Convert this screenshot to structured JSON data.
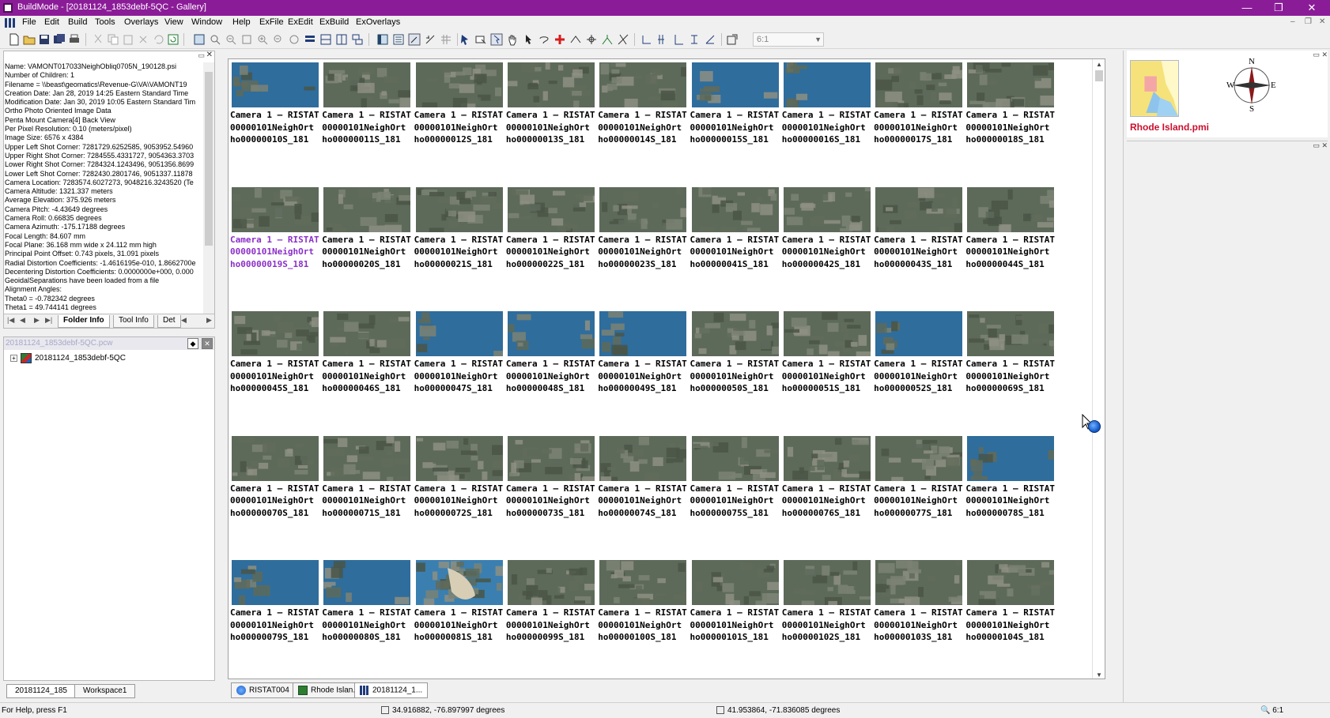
{
  "window": {
    "title": "BuildMode - [20181124_1853debf-5QC - Gallery]",
    "minimize": "—",
    "maximize": "❐",
    "close": "✕"
  },
  "menubar": {
    "items": [
      "File",
      "Edit",
      "Build",
      "Tools",
      "Overlays",
      "View",
      "Window",
      "Help",
      "ExFile",
      "ExEdit",
      "ExBuild",
      "ExOverlays"
    ],
    "mdi_minimize": "–",
    "mdi_restore": "❐",
    "mdi_close": "✕"
  },
  "toolbar": {
    "zoom_value": "6:1"
  },
  "info_panel": {
    "lines": [
      "Name: VAMONT017033NeighObliq0705N_190128.psi",
      "Number of Children: 1",
      "Filename = \\\\beast\\geomatics\\Revenue-G\\VA\\VAMONT19",
      "Creation Date: Jan 28, 2019 14:25 Eastern Standard Time",
      "Modification Date: Jan 30, 2019 10:05 Eastern Standard Tim",
      "Ortho Photo Oriented Image Data",
      "Penta Mount Camera[4]          Back View",
      "Per Pixel Resolution: 0.10 (meters/pixel)",
      "Image Size: 6576 x 4384",
      "Upper Left Shot Corner: 7281729.6252585, 9053952.54960",
      "Upper Right Shot Corner: 7284555.4331727, 9054363.3703",
      "Lower Right Shot Corner: 7284324.1243496, 9051356.8699",
      "Lower Left Shot Corner: 7282430.2801746, 9051337.11878",
      "Camera Location: 7283574.6027273, 9048216.3243520 (Te",
      "Camera Altitude: 1321.337 meters",
      "Average Elevation: 375.926 meters",
      "Camera Pitch: -4.43649 degrees",
      "Camera Roll: 0.66835 degrees",
      "Camera Azimuth: -175.17188 degrees",
      "Focal Length: 84.607 mm",
      "Focal Plane: 36.168 mm wide x 24.112 mm high",
      "Principal Point Offset: 0.743 pixels, 31.091 pixels",
      "Radial Distortion Coefficients: -1.4616195e-010, 1.8662700e",
      "Decentering Distortion Coefficients: 0.0000000e+000, 0.000",
      "GeoidalSeparations have been loaded from a file",
      "Alignment Angles:",
      "  Theta0 = -0.782342 degrees",
      "  Theta1 = 49.744141 degrees"
    ],
    "tabs": [
      "Folder Info",
      "Tool Info",
      "Det"
    ]
  },
  "tree_panel": {
    "header": "20181124_1853debf-5QC.pcw",
    "root_label": "20181124_1853debf-5QC"
  },
  "left_bottom_tabs": [
    "20181124_185",
    "Workspace1"
  ],
  "gallery": {
    "rows": [
      [
        [
          "Camera 1 — RISTAT",
          "00000101NeighOrt",
          "ho00000010S_181"
        ],
        [
          "Camera 1 — RISTAT",
          "00000101NeighOrt",
          "ho00000011S_181"
        ],
        [
          "Camera 1 — RISTAT",
          "00000101NeighOrt",
          "ho00000012S_181"
        ],
        [
          "Camera 1 — RISTAT",
          "00000101NeighOrt",
          "ho00000013S_181"
        ],
        [
          "Camera 1 — RISTAT",
          "00000101NeighOrt",
          "ho00000014S_181"
        ],
        [
          "Camera 1 — RISTAT",
          "00000101NeighOrt",
          "ho00000015S_181"
        ],
        [
          "Camera 1 — RISTAT",
          "00000101NeighOrt",
          "ho00000016S_181"
        ],
        [
          "Camera 1 — RISTAT",
          "00000101NeighOrt",
          "ho00000017S_181"
        ],
        [
          "Camera 1 — RISTAT",
          "00000101NeighOrt",
          "ho00000018S_181"
        ]
      ],
      [
        [
          "Camera 1 — RISTAT",
          "00000101NeighOrt",
          "ho00000019S_181"
        ],
        [
          "Camera 1 — RISTAT",
          "00000101NeighOrt",
          "ho00000020S_181"
        ],
        [
          "Camera 1 — RISTAT",
          "00000101NeighOrt",
          "ho00000021S_181"
        ],
        [
          "Camera 1 — RISTAT",
          "00000101NeighOrt",
          "ho00000022S_181"
        ],
        [
          "Camera 1 — RISTAT",
          "00000101NeighOrt",
          "ho00000023S_181"
        ],
        [
          "Camera 1 — RISTAT",
          "00000101NeighOrt",
          "ho00000041S_181"
        ],
        [
          "Camera 1 — RISTAT",
          "00000101NeighOrt",
          "ho00000042S_181"
        ],
        [
          "Camera 1 — RISTAT",
          "00000101NeighOrt",
          "ho00000043S_181"
        ],
        [
          "Camera 1 — RISTAT",
          "00000101NeighOrt",
          "ho00000044S_181"
        ]
      ],
      [
        [
          "Camera 1 — RISTAT",
          "00000101NeighOrt",
          "ho00000045S_181"
        ],
        [
          "Camera 1 — RISTAT",
          "00000101NeighOrt",
          "ho00000046S_181"
        ],
        [
          "Camera 1 — RISTAT",
          "00000101NeighOrt",
          "ho00000047S_181"
        ],
        [
          "Camera 1 — RISTAT",
          "00000101NeighOrt",
          "ho00000048S_181"
        ],
        [
          "Camera 1 — RISTAT",
          "00000101NeighOrt",
          "ho00000049S_181"
        ],
        [
          "Camera 1 — RISTAT",
          "00000101NeighOrt",
          "ho00000050S_181"
        ],
        [
          "Camera 1 — RISTAT",
          "00000101NeighOrt",
          "ho00000051S_181"
        ],
        [
          "Camera 1 — RISTAT",
          "00000101NeighOrt",
          "ho00000052S_181"
        ],
        [
          "Camera 1 — RISTAT",
          "00000101NeighOrt",
          "ho00000069S_181"
        ]
      ],
      [
        [
          "Camera 1 — RISTAT",
          "00000101NeighOrt",
          "ho00000070S_181"
        ],
        [
          "Camera 1 — RISTAT",
          "00000101NeighOrt",
          "ho00000071S_181"
        ],
        [
          "Camera 1 — RISTAT",
          "00000101NeighOrt",
          "ho00000072S_181"
        ],
        [
          "Camera 1 — RISTAT",
          "00000101NeighOrt",
          "ho00000073S_181"
        ],
        [
          "Camera 1 — RISTAT",
          "00000101NeighOrt",
          "ho00000074S_181"
        ],
        [
          "Camera 1 — RISTAT",
          "00000101NeighOrt",
          "ho00000075S_181"
        ],
        [
          "Camera 1 — RISTAT",
          "00000101NeighOrt",
          "ho00000076S_181"
        ],
        [
          "Camera 1 — RISTAT",
          "00000101NeighOrt",
          "ho00000077S_181"
        ],
        [
          "Camera 1 — RISTAT",
          "00000101NeighOrt",
          "ho00000078S_181"
        ]
      ],
      [
        [
          "Camera 1 — RISTAT",
          "00000101NeighOrt",
          "ho00000079S_181"
        ],
        [
          "Camera 1 — RISTAT",
          "00000101NeighOrt",
          "ho00000080S_181"
        ],
        [
          "Camera 1 — RISTAT",
          "00000101NeighOrt",
          "ho00000081S_181"
        ],
        [
          "Camera 1 — RISTAT",
          "00000101NeighOrt",
          "ho00000099S_181"
        ],
        [
          "Camera 1 — RISTAT",
          "00000101NeighOrt",
          "ho00000100S_181"
        ],
        [
          "Camera 1 — RISTAT",
          "00000101NeighOrt",
          "ho00000101S_181"
        ],
        [
          "Camera 1 — RISTAT",
          "00000101NeighOrt",
          "ho00000102S_181"
        ],
        [
          "Camera 1 — RISTAT",
          "00000101NeighOrt",
          "ho00000103S_181"
        ],
        [
          "Camera 1 — RISTAT",
          "00000101NeighOrt",
          "ho00000104S_181"
        ]
      ]
    ],
    "selected": [
      1,
      0
    ],
    "thumb_palette": {
      "urban": [
        "#5d6a5a",
        "#7b8274",
        "#4a5546",
        "#8d8f82",
        "#626b5b"
      ],
      "water": [
        "#2f6d9c",
        "#3a7fb0",
        "#245c87",
        "#4b8bb8"
      ],
      "sand": [
        "#d8ceb5",
        "#e6dcc6"
      ]
    },
    "thumb_types": [
      [
        "water",
        "urban",
        "urban",
        "urban",
        "urban",
        "water",
        "water",
        "urban",
        "urban"
      ],
      [
        "urban",
        "urban",
        "urban",
        "urban",
        "urban",
        "urban",
        "urban",
        "urban",
        "urban"
      ],
      [
        "urban",
        "urban",
        "water",
        "water",
        "water",
        "urban",
        "urban",
        "water",
        "urban"
      ],
      [
        "urban",
        "urban",
        "urban",
        "urban",
        "urban",
        "urban",
        "urban",
        "urban",
        "water"
      ],
      [
        "water",
        "water",
        "sand",
        "urban",
        "urban",
        "urban",
        "urban",
        "urban",
        "urban"
      ]
    ]
  },
  "doc_tabs": [
    "RISTAT004",
    "Rhode Islan...",
    "20181124_1..."
  ],
  "right_panel": {
    "map_label": "Rhode Island.pmi",
    "compass": {
      "n": "N",
      "s": "S",
      "e": "E",
      "w": "W"
    }
  },
  "statusbar": {
    "help": "For Help, press F1",
    "coord1": "34.916882, -76.897997  degrees",
    "coord2": "41.953864, -71.836085 degrees",
    "zoom": "6:1"
  },
  "colors": {
    "titlebar": "#8b1c98",
    "selected_caption": "#8b2fc9",
    "map_label": "#c8102e"
  }
}
